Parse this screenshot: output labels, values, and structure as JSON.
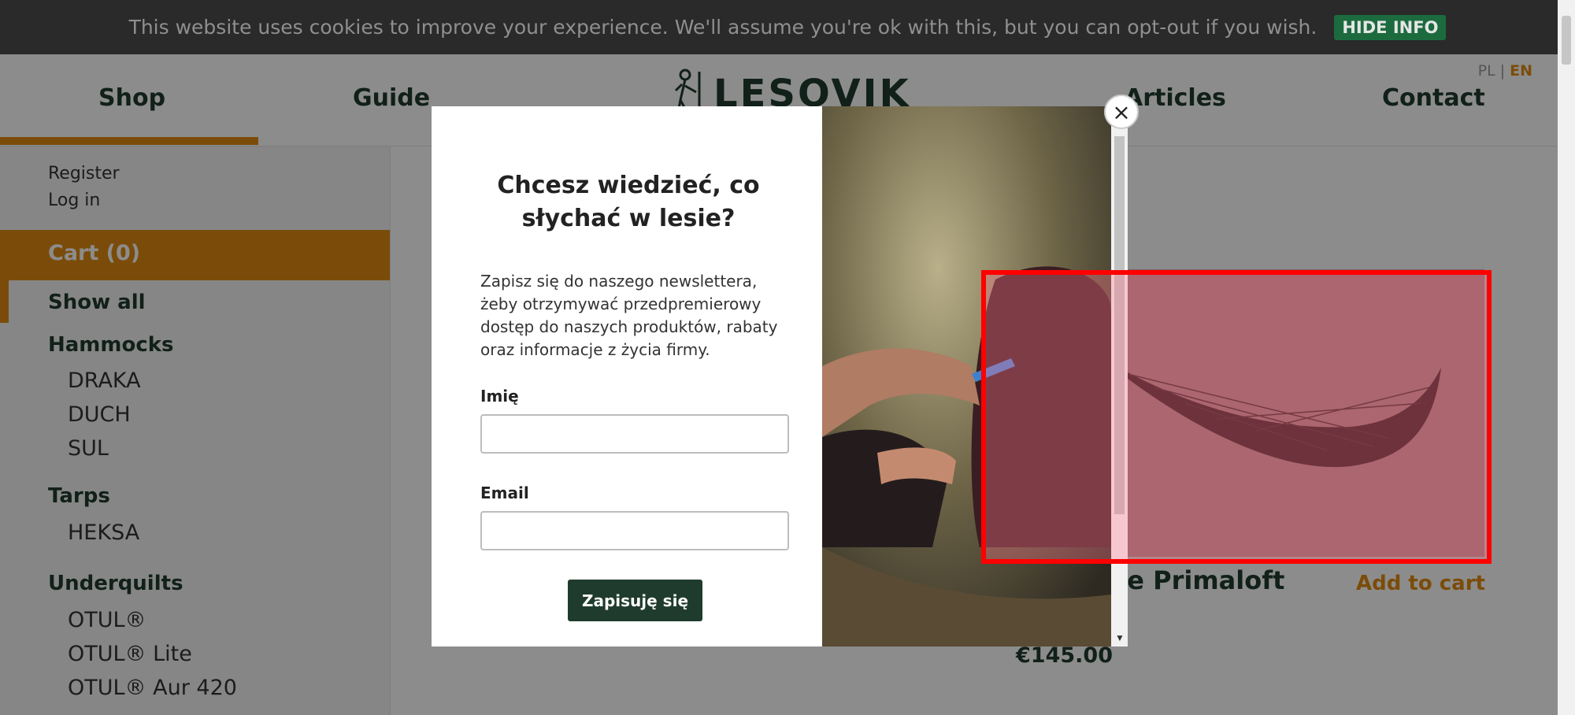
{
  "cookie": {
    "text": "This website uses cookies to improve your experience. We'll assume you're ok with this, but you can opt-out if you wish.",
    "button": "HIDE INFO"
  },
  "header": {
    "nav": [
      "Shop",
      "Guide",
      "Articles",
      "Contact"
    ],
    "logo_text": "LESOVIK",
    "lang_pl": "PL",
    "lang_sep": "|",
    "lang_en": "EN"
  },
  "sidebar": {
    "register": "Register",
    "login": "Log in",
    "cart": "Cart (0)",
    "show_all": "Show all",
    "hammocks": "Hammocks",
    "hammock_items": [
      "DRAKA",
      "DUCH",
      "SUL"
    ],
    "tarps": "Tarps",
    "tarp_items": [
      "HEKSA"
    ],
    "underquilts": "Underquilts",
    "underquilt_items": [
      "OTUL®",
      "OTUL® Lite",
      "OTUL® Aur 420"
    ]
  },
  "product": {
    "title_fragment": "ite Primaloft",
    "add_to_cart": "Add to cart",
    "price": "€145.00"
  },
  "modal": {
    "heading": "Chcesz wiedzieć, co słychać w lesie?",
    "description": "Zapisz się do naszego newslettera, żeby otrzymywać przedpremierowy dostęp do naszych produktów, rabaty oraz informacje z życia firmy.",
    "name_label": "Imię",
    "email_label": "Email",
    "submit": "Zapisuję się",
    "close": "×"
  },
  "colors": {
    "accent": "#e08a12",
    "brand_green": "#1f3b2d",
    "cookie_bg": "#2a2a2a",
    "highlight": "#ff0000"
  }
}
